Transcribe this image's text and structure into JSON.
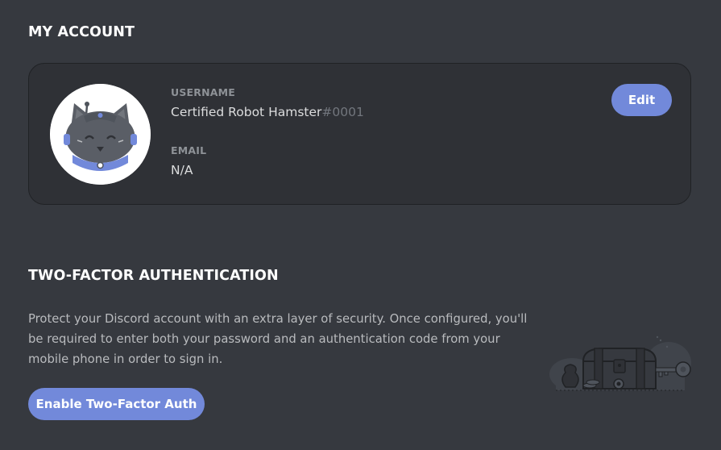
{
  "account": {
    "title": "MY ACCOUNT",
    "username_label": "USERNAME",
    "username": "Certified Robot Hamster",
    "discriminator": "#0001",
    "email_label": "EMAIL",
    "email": "N/A",
    "edit_label": "Edit"
  },
  "tfa": {
    "title": "TWO-FACTOR AUTHENTICATION",
    "description": "Protect your Discord account with an extra layer of security. Once configured, you'll be required to enter both your password and an authentication code from your mobile phone in order to sign in.",
    "enable_label": "Enable Two-Factor Auth"
  },
  "icons": {
    "avatar": "robot-hamster-avatar",
    "illustration": "treasure-chest-key-illustration"
  },
  "colors": {
    "background": "#36393f",
    "card": "#2f3136",
    "accent": "#7289da",
    "text_muted": "#8e9297",
    "text_normal": "#dcddde"
  }
}
